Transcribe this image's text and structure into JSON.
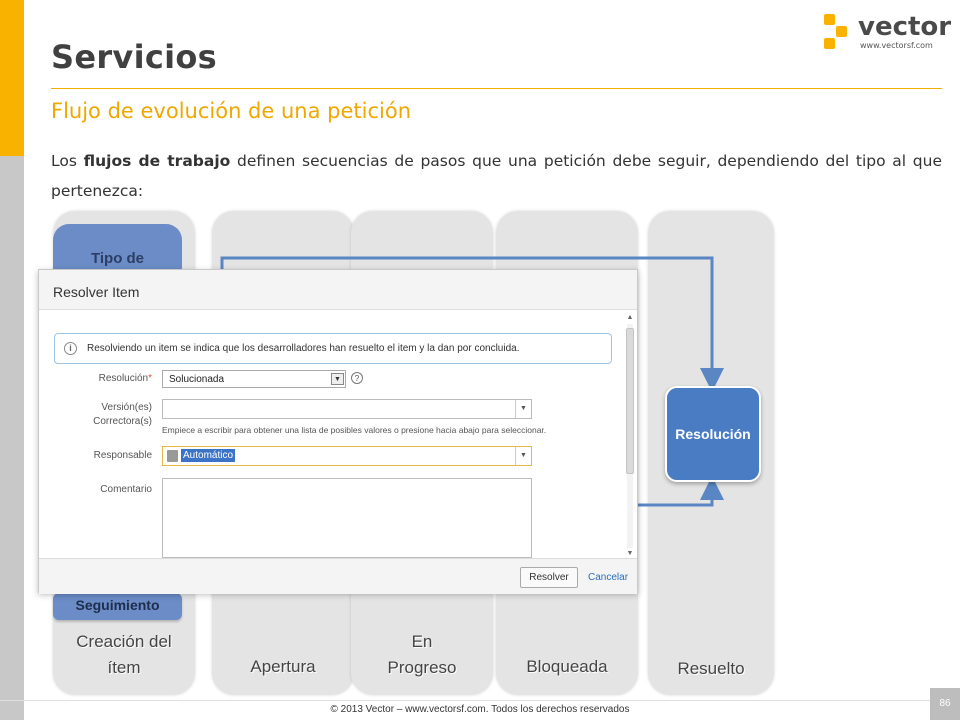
{
  "slide": {
    "title": "Servicios",
    "subtitle": "Flujo de evolución de una petición",
    "body": {
      "prefix": "Los ",
      "bold": "flujos de trabajo",
      "suffix": " definen secuencias de pasos que una petición debe seguir, dependiendo del tipo al que pertenezca:"
    }
  },
  "logo": {
    "name": "vector",
    "url": "www.vectorsf.com",
    "accent": "#f9b200"
  },
  "lanes": [
    {
      "label_line1": "Creación del",
      "label_line2": "ítem"
    },
    {
      "label_line1": "Apertura",
      "label_line2": ""
    },
    {
      "label_line1": "En",
      "label_line2": "Progreso"
    },
    {
      "label_line1": "Bloqueada",
      "label_line2": ""
    },
    {
      "label_line1": "Resuelto",
      "label_line2": ""
    }
  ],
  "boxes": {
    "tipo": "Tipo de",
    "seguimiento": "Seguimiento",
    "resolucion": "Resolución"
  },
  "dialog": {
    "title": "Resolver Item",
    "info": "Resolviendo un item se indica que los desarrolladores han resuelto el item y la dan por concluida.",
    "fields": {
      "resolucion_label": "Resolución",
      "resolucion_value": "Solucionada",
      "version_label_1": "Versión(es)",
      "version_label_2": "Correctora(s)",
      "version_hint": "Empiece a escribir para obtener una lista de posibles valores o presione hacia abajo para seleccionar.",
      "responsable_label": "Responsable",
      "responsable_value": "Automático",
      "comentario_label": "Comentario"
    },
    "buttons": {
      "resolver": "Resolver",
      "cancelar": "Cancelar"
    }
  },
  "footer": {
    "copyright": "© 2013 Vector – www.vectorsf.com. Todos los derechos reservados",
    "page": "86"
  },
  "colors": {
    "accent_orange": "#f9b200",
    "box_blue": "#6b8cc7",
    "resolucion_blue": "#4a7cc4",
    "connector_blue": "#5a86c4"
  }
}
